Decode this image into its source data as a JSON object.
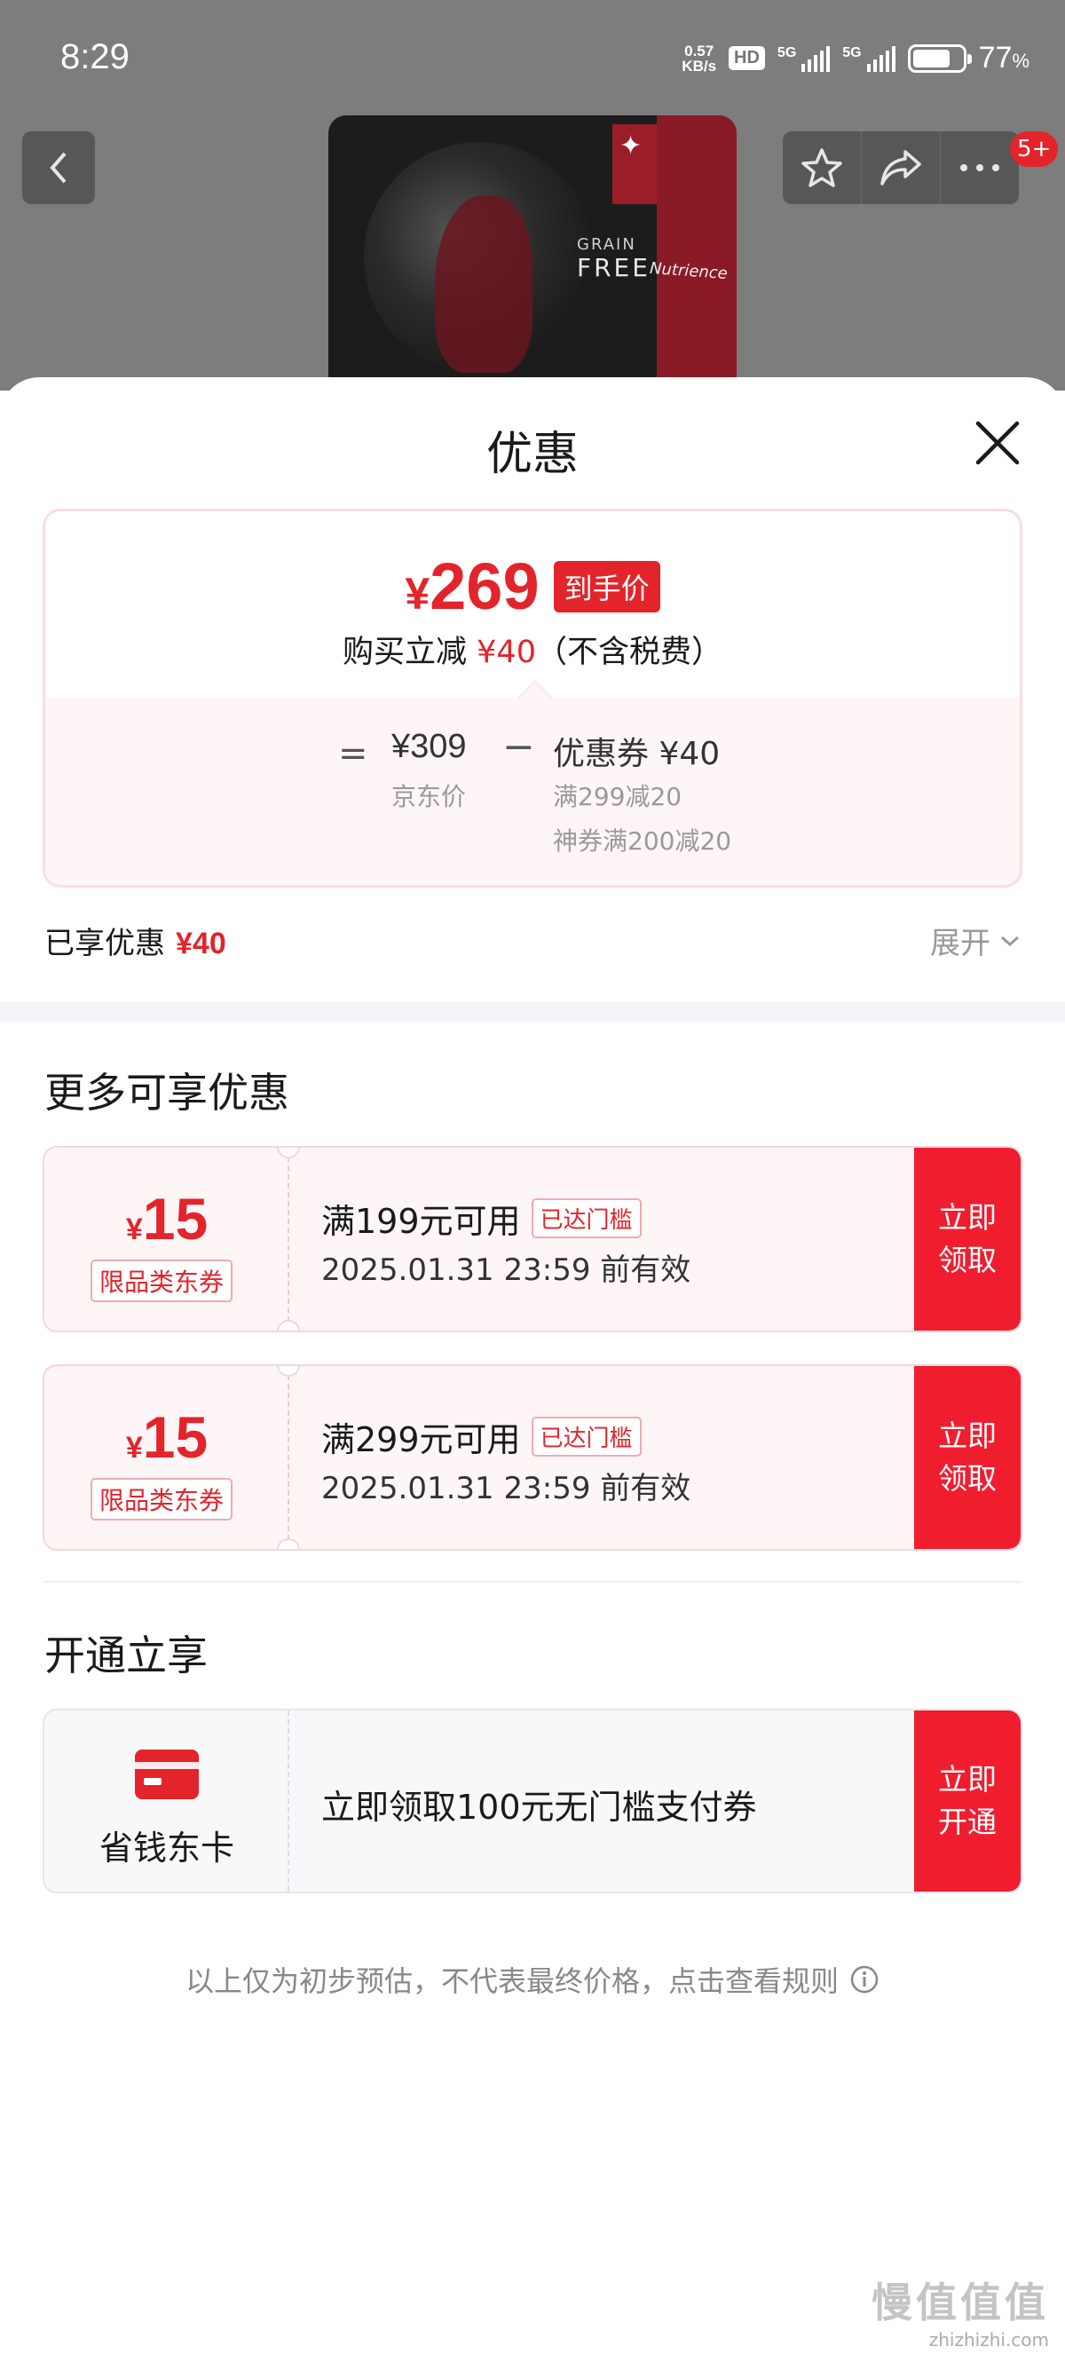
{
  "status_bar": {
    "time": "8:29",
    "net_speed_value": "0.57",
    "net_speed_unit": "KB/s",
    "hd_label": "HD",
    "signal1_label": "5G",
    "signal2_label": "5G",
    "battery_percent": "77",
    "battery_unit": "%",
    "battery_level": 0.77
  },
  "background_page": {
    "product_text_grain": "GRAIN",
    "product_text_free": "FREE",
    "product_brand": "Nutrience",
    "message_badge": "5+"
  },
  "sheet": {
    "title": "优惠",
    "price_card": {
      "currency": "¥",
      "final_price": "269",
      "final_tag": "到手价",
      "save_prefix": "购买立减",
      "save_amount": "¥40",
      "save_suffix": "（不含税费）",
      "equals": "=",
      "jd_price": "¥309",
      "jd_label": "京东价",
      "minus": "−",
      "coupon_label": "优惠券 ¥40",
      "coupon_detail_1": "满299减20",
      "coupon_detail_2": "神券满200减20"
    },
    "enjoyed_label": "已享优惠",
    "enjoyed_amount": "¥40",
    "expand_label": "展开",
    "more_title": "更多可享优惠",
    "coupons": [
      {
        "currency": "¥",
        "amount": "15",
        "type": "限品类东券",
        "condition": "满199元可用",
        "reached": "已达门槛",
        "valid": "2025.01.31 23:59 前有效",
        "button": "立即领取"
      },
      {
        "currency": "¥",
        "amount": "15",
        "type": "限品类东券",
        "condition": "满299元可用",
        "reached": "已达门槛",
        "valid": "2025.01.31 23:59 前有效",
        "button": "立即领取"
      }
    ],
    "open_title": "开通立享",
    "membership": {
      "name": "省钱东卡",
      "desc": "立即领取100元无门槛支付券",
      "button": "立即开通"
    },
    "disclaimer": "以上仅为初步预估，不代表最终价格，点击查看规则"
  },
  "watermark": {
    "line1": "慢值值值",
    "line2": "zhizhizhi.com"
  },
  "colors": {
    "accent_red": "#e3242b",
    "button_red": "#f01d2f",
    "coupon_bg": "#fef6f6",
    "dim_overlay": "#7d7d7d"
  },
  "icons": [
    "back-arrow-icon",
    "star-icon",
    "share-icon",
    "more-icon",
    "close-icon",
    "chevron-down-icon",
    "member-card-icon",
    "info-icon"
  ]
}
